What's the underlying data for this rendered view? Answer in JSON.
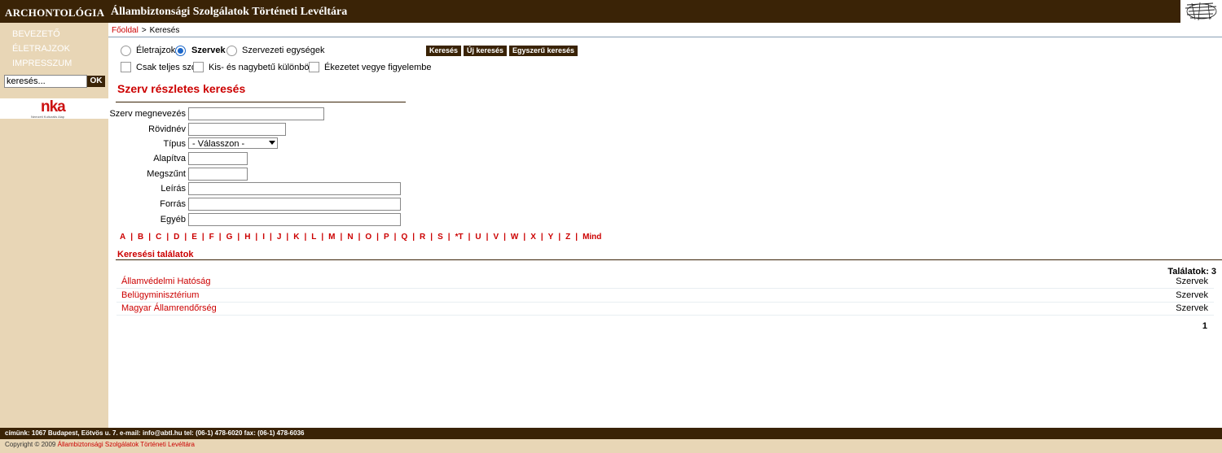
{
  "header": {
    "site_name": "ARCHONTOLÓGIA",
    "archive_title": "Állambiztonsági Szolgálatok Történeti Levéltára"
  },
  "sidebar": {
    "items": [
      {
        "label": "Bevezető"
      },
      {
        "label": "Életrajzok"
      },
      {
        "label": "Impresszum"
      }
    ],
    "search": {
      "placeholder": "keresés...",
      "value": "keresés..."
    },
    "ok_label": "OK",
    "nka_logo": "nka",
    "nka_sub": "Nemzeti Kulturális Alap"
  },
  "breadcrumb": {
    "home": "Főoldal",
    "separator": ">",
    "current": "Keresés"
  },
  "search_types": [
    {
      "label": "Életrajzok",
      "selected": false
    },
    {
      "label": "Szervek",
      "selected": true
    },
    {
      "label": "Szervezeti egységek",
      "selected": false
    }
  ],
  "options": [
    {
      "label": "Csak teljes szó",
      "checked": false
    },
    {
      "label": "Kis- és nagybetű különböző",
      "checked": false
    },
    {
      "label": "Ékezetet vegye figyelembe",
      "checked": false
    }
  ],
  "buttons": {
    "search": "Keresés",
    "new_search": "Új keresés",
    "simple_search": "Egyszerű keresés"
  },
  "form": {
    "title": "Szerv részletes keresés",
    "fields": {
      "name": "Szerv megnevezés",
      "short": "Rövidnév",
      "type": "Típus",
      "founded": "Alapítva",
      "ended": "Megszűnt",
      "description": "Leírás",
      "source": "Forrás",
      "other": "Egyéb"
    },
    "type_selected": "- Válasszon -"
  },
  "alphabet": [
    "A",
    "B",
    "C",
    "D",
    "E",
    "F",
    "G",
    "H",
    "I",
    "J",
    "K",
    "L",
    "M",
    "N",
    "O",
    "P",
    "Q",
    "R",
    "S",
    "*T",
    "U",
    "V",
    "W",
    "X",
    "Y",
    "Z",
    "Mind"
  ],
  "results": {
    "title": "Keresési találatok",
    "count_label": "Találatok:",
    "count": "3",
    "rows": [
      {
        "name": "Államvédelmi Hatóság",
        "type": "Szervek"
      },
      {
        "name": "Belügyminisztérium",
        "type": "Szervek"
      },
      {
        "name": "Magyar Államrendőrség",
        "type": "Szervek"
      }
    ],
    "page": "1"
  },
  "footer": {
    "address": "címünk: 1067 Budapest, Eötvös u. 7. e-mail: info@abtl.hu tel: (06-1) 478-6020 fax: (06-1) 478-6036",
    "copyright": "Copyright © 2009",
    "copyright_link": "Állambiztonsági Szolgálatok Történeti Levéltára"
  }
}
